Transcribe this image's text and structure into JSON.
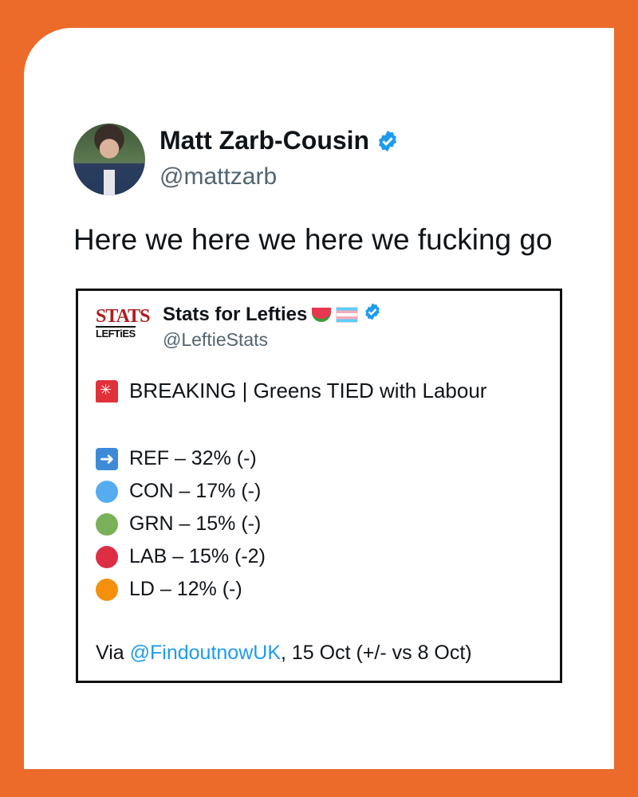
{
  "tweet": {
    "author_name": "Matt Zarb-Cousin",
    "author_handle": "@mattzarb",
    "text": "Here we here we here we fucking go"
  },
  "quoted": {
    "logo_line1": "STATS",
    "logo_line2": "LEFTiES",
    "author_name": "Stats for Lefties",
    "author_handle": "@LeftieStats",
    "headline": "BREAKING | Greens TIED with Labour",
    "rows": [
      {
        "label": "REF – 32% (-)",
        "marker": "arrow-right-icon",
        "color": "#3c8ad8"
      },
      {
        "label": "CON – 17% (-)",
        "marker": "blue-circle-icon",
        "color": "#55acee"
      },
      {
        "label": "GRN – 15% (-)",
        "marker": "green-circle-icon",
        "color": "#78b159"
      },
      {
        "label": "LAB – 15% (-2)",
        "marker": "red-circle-icon",
        "color": "#dd2e44"
      },
      {
        "label": "LD – 12% (-)",
        "marker": "orange-circle-icon",
        "color": "#f4900c"
      }
    ],
    "footer_prefix": "Via ",
    "footer_link": "@FindoutnowUK",
    "footer_suffix": ", 15 Oct (+/- vs 8 Oct)"
  },
  "colors": {
    "background": "#ec6a2a",
    "verified": "#1d9bf0",
    "link": "#1d9bf0"
  }
}
